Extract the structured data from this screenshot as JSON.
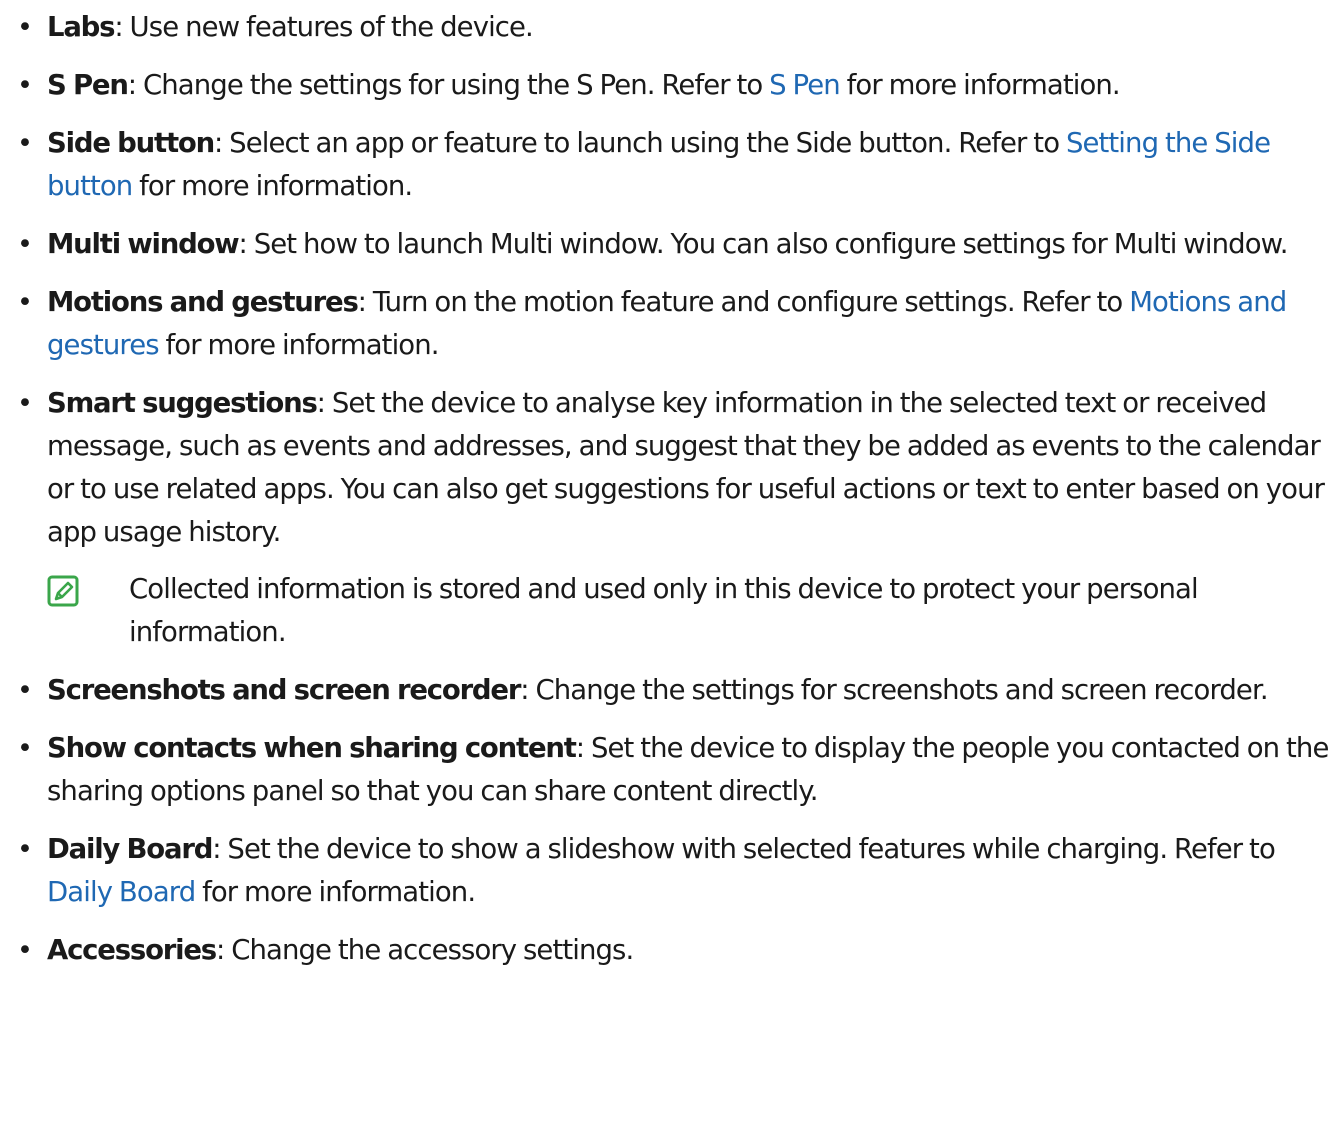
{
  "colors": {
    "text": "#1a1a1a",
    "link": "#1f68b3",
    "note_icon": "#3aa64a"
  },
  "items": [
    {
      "term": "Labs",
      "parts": [
        ": Use new features of the device."
      ]
    },
    {
      "term": "S Pen",
      "parts": [
        ": Change the settings for using the S Pen. Refer to ",
        "S Pen",
        " for more information."
      ]
    },
    {
      "term": "Side button",
      "parts": [
        ": Select an app or feature to launch using the Side button. Refer to ",
        "Setting the Side button",
        " for more information."
      ]
    },
    {
      "term": "Multi window",
      "parts": [
        ": Set how to launch Multi window. You can also configure settings for Multi window."
      ]
    },
    {
      "term": "Motions and gestures",
      "parts": [
        ": Turn on the motion feature and configure settings. Refer to ",
        "Motions and gestures",
        " for more information."
      ]
    },
    {
      "term": "Smart suggestions",
      "parts": [
        ": Set the device to analyse key information in the selected text or received message, such as events and addresses, and suggest that they be added as events to the calendar or to use related apps. You can also get suggestions for useful actions or text to enter based on your app usage history."
      ],
      "note": "Collected information is stored and used only in this device to protect your personal information.",
      "note_icon": "note-pen-icon"
    },
    {
      "term": "Screenshots and screen recorder",
      "parts": [
        ": Change the settings for screenshots and screen recorder."
      ]
    },
    {
      "term": "Show contacts when sharing content",
      "parts": [
        ": Set the device to display the people you contacted on the sharing options panel so that you can share content directly."
      ]
    },
    {
      "term": "Daily Board",
      "parts": [
        ": Set the device to show a slideshow with selected features while charging. Refer to ",
        "Daily Board",
        " for more information."
      ]
    },
    {
      "term": "Accessories",
      "parts": [
        ": Change the accessory settings."
      ]
    }
  ]
}
